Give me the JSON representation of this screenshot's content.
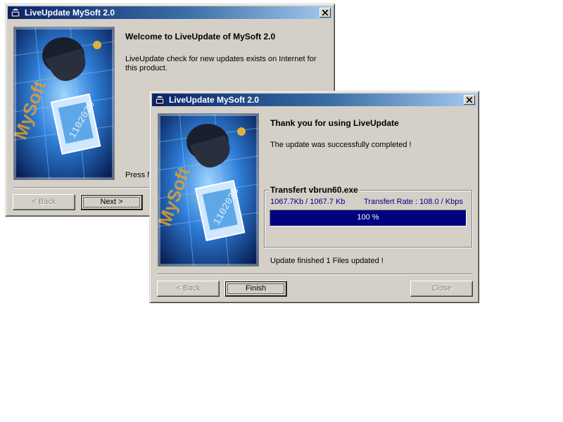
{
  "back_window": {
    "title": "LiveUpdate MySoft 2.0",
    "heading": "Welcome to LiveUpdate of MySoft 2.0",
    "body": "LiveUpdate check for new updates exists on Internet for this product.",
    "partial_text": "Press N",
    "buttons": {
      "back": "< Back",
      "next": "Next >"
    },
    "splash_text": "MySoft 1102030"
  },
  "front_window": {
    "title": "LiveUpdate MySoft 2.0",
    "heading": "Thank you for using LiveUpdate",
    "message": "The update was successfully completed !",
    "transfer": {
      "group_label": "Transfert vbrun60.exe",
      "size": "1067.7Kb / 1067.7 Kb",
      "rate": "Transfert Rate : 108.0 / Kbps",
      "progress_label": "100 %",
      "progress_fraction": 1.0
    },
    "status": "Update finished 1 Files updated !",
    "buttons": {
      "back": "< Back",
      "finish": "Finish",
      "close": "Close"
    },
    "splash_text": "MySoft 1102030"
  },
  "colors": {
    "title_start": "#0a246a",
    "title_end": "#a6caf0",
    "progress": "#000080",
    "face": "#d4d0c8"
  }
}
